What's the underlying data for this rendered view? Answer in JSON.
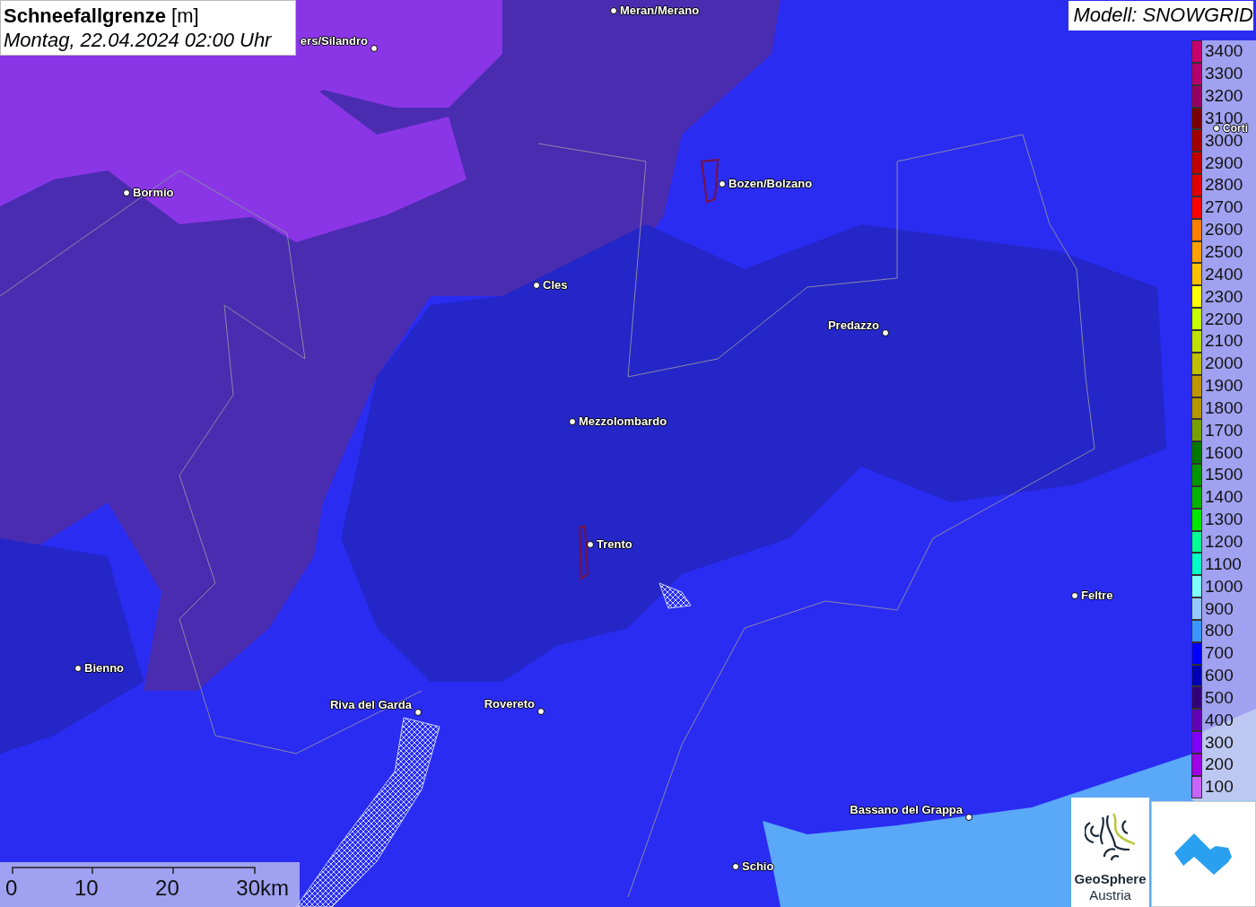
{
  "title": {
    "name": "Schneefallgrenze",
    "unit": "[m]",
    "date": "Montag, 22.04.2024 02:00 Uhr"
  },
  "model": "Modell: SNOWGRID",
  "cities": [
    {
      "name": "Meran/Merano"
    },
    {
      "name": "ers/Silandro"
    },
    {
      "name": "Bormio"
    },
    {
      "name": "Bozen/Bolzano"
    },
    {
      "name": "Cles"
    },
    {
      "name": "Predazzo"
    },
    {
      "name": "Mezzolombardo"
    },
    {
      "name": "Trento"
    },
    {
      "name": "Feltre"
    },
    {
      "name": "Bienno"
    },
    {
      "name": "Riva del Garda"
    },
    {
      "name": "Rovereto"
    },
    {
      "name": "Bassano del Grappa"
    },
    {
      "name": "Schio"
    },
    {
      "name": "Corti"
    }
  ],
  "legend": [
    {
      "label": "3400",
      "color": "#c8006e"
    },
    {
      "label": "3300",
      "color": "#b4006e"
    },
    {
      "label": "3200",
      "color": "#960064"
    },
    {
      "label": "3100",
      "color": "#780000"
    },
    {
      "label": "3000",
      "color": "#a00000"
    },
    {
      "label": "2900",
      "color": "#c00000"
    },
    {
      "label": "2800",
      "color": "#e00000"
    },
    {
      "label": "2700",
      "color": "#ff0000"
    },
    {
      "label": "2600",
      "color": "#ff8000"
    },
    {
      "label": "2500",
      "color": "#ffa000"
    },
    {
      "label": "2400",
      "color": "#ffc000"
    },
    {
      "label": "2300",
      "color": "#ffff00"
    },
    {
      "label": "2200",
      "color": "#c8ff00"
    },
    {
      "label": "2100",
      "color": "#c0e000"
    },
    {
      "label": "2000",
      "color": "#c0c000"
    },
    {
      "label": "1900",
      "color": "#c09600"
    },
    {
      "label": "1800",
      "color": "#b49600"
    },
    {
      "label": "1700",
      "color": "#78a000"
    },
    {
      "label": "1600",
      "color": "#007800"
    },
    {
      "label": "1500",
      "color": "#009600"
    },
    {
      "label": "1400",
      "color": "#00b400"
    },
    {
      "label": "1300",
      "color": "#00e600"
    },
    {
      "label": "1200",
      "color": "#00ff96"
    },
    {
      "label": "1100",
      "color": "#00ffc8"
    },
    {
      "label": "1000",
      "color": "#80ffff"
    },
    {
      "label": "900",
      "color": "#96c8ff"
    },
    {
      "label": "800",
      "color": "#3c96ff"
    },
    {
      "label": "700",
      "color": "#0000ff"
    },
    {
      "label": "600",
      "color": "#0000b4"
    },
    {
      "label": "500",
      "color": "#320078"
    },
    {
      "label": "400",
      "color": "#6400b4"
    },
    {
      "label": "300",
      "color": "#8200ff"
    },
    {
      "label": "200",
      "color": "#a000e6"
    },
    {
      "label": "100",
      "color": "#c864ff"
    }
  ],
  "scale": {
    "ticks": [
      "0",
      "10",
      "20",
      "30km"
    ]
  },
  "logo": {
    "line1": "GeoSphere",
    "line2": "Austria"
  }
}
